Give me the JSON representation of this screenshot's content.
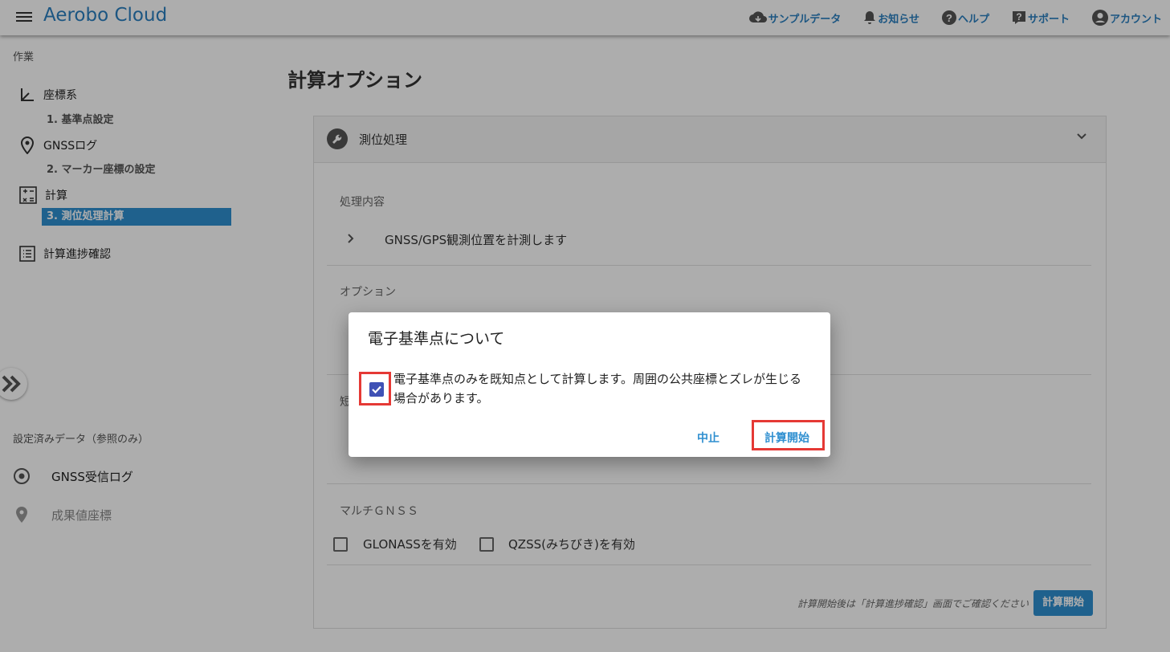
{
  "header": {
    "brand": "Aerobo Cloud",
    "nav": [
      {
        "label": "サンプルデータ",
        "icon": "cloud-download-icon"
      },
      {
        "label": "お知らせ",
        "icon": "bell-icon"
      },
      {
        "label": "ヘルプ",
        "icon": "help-circle-icon"
      },
      {
        "label": "サポート",
        "icon": "help-box-icon"
      },
      {
        "label": "アカウント",
        "icon": "account-icon"
      }
    ]
  },
  "sidebar": {
    "section_title": "作業",
    "items": [
      {
        "label": "座標系",
        "icon": "axis-icon",
        "sub": "1. 基準点設定"
      },
      {
        "label": "GNSSログ",
        "icon": "location-pin-icon",
        "sub": "2. マーカー座標の設定"
      },
      {
        "label": "計算",
        "icon": "calculator-icon",
        "sub": "3. 測位処理計算"
      },
      {
        "label": "計算進捗確認",
        "icon": "list-icon"
      }
    ],
    "ref_title": "設定済みデータ（参照のみ）",
    "ref_items": [
      {
        "label": "GNSS受信ログ",
        "icon": "radio-target-icon"
      },
      {
        "label": "成果値座標",
        "icon": "map-marker-icon"
      }
    ]
  },
  "main": {
    "title": "計算オプション",
    "card_title": "測位処理",
    "section1_label": "処理内容",
    "section1_text": "GNSS/GPS観測位置を計測します",
    "section2_label": "オプション",
    "section3_label_partial": "短",
    "multi_label": "マルチＧＮＳＳ",
    "checkbox1": "GLONASSを有効",
    "checkbox2": "QZSS(みちびき)を有効",
    "footer_note": "計算開始後は「計算進捗確認」画面でご確認ください",
    "start_button": "計算開始"
  },
  "dialog": {
    "title": "電子基準点について",
    "checkbox_checked": true,
    "text": "電子基準点のみを既知点として計算します。周囲の公共座標とズレが生じる場合があります。",
    "cancel": "中止",
    "start": "計算開始"
  },
  "colors": {
    "accent": "#2f8fd0",
    "highlight": "#e53935",
    "checkbox": "#3f51b5"
  }
}
